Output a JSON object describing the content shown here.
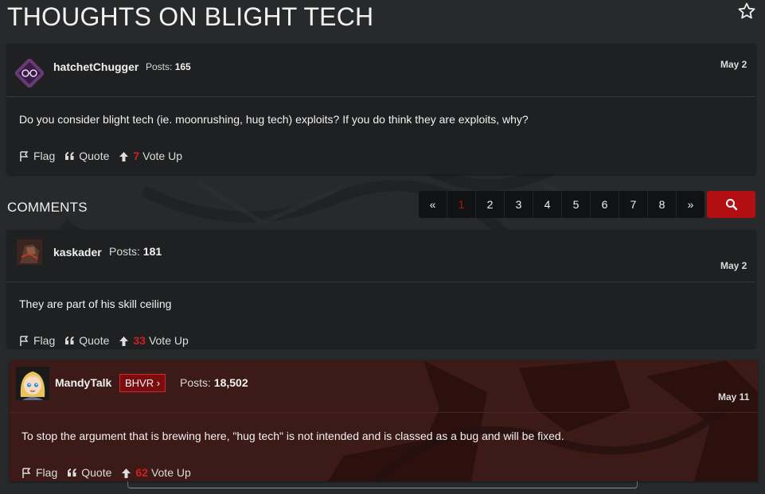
{
  "page": {
    "title": "THOUGHTS ON BLIGHT TECH"
  },
  "icons": {
    "favorite": "star-outline-icon",
    "flag": "flag-icon",
    "quote": "quote-icon",
    "vote": "arrow-up-icon",
    "search": "search-icon"
  },
  "colors": {
    "accent": "#b30f12",
    "vote_count": "#d21f1f",
    "background": "#27292b",
    "card": "#1f2021"
  },
  "op": {
    "username": "hatchetChugger",
    "posts_label": "Posts:",
    "posts_count": "165",
    "date": "May 2",
    "body": "Do you consider blight tech (ie. moonrushing, hug tech) exploits? If you do think they are exploits, why?",
    "actions": {
      "flag": "Flag",
      "quote": "Quote",
      "votes": "7",
      "vote_label": "Vote Up"
    }
  },
  "comments_heading": "COMMENTS",
  "pagination": {
    "prev": "«",
    "pages": [
      "1",
      "2",
      "3",
      "4",
      "5",
      "6",
      "7",
      "8"
    ],
    "next": "»",
    "current": "1"
  },
  "comments": [
    {
      "username": "kaskader",
      "posts_label": "Posts:",
      "posts_count": "181",
      "date": "May 2",
      "body": "They are part of his skill ceiling",
      "actions": {
        "flag": "Flag",
        "quote": "Quote",
        "votes": "33",
        "vote_label": "Vote Up"
      }
    },
    {
      "username": "MandyTalk",
      "badge": "BHVR ›",
      "posts_label": "Posts:",
      "posts_count": "18,502",
      "date": "May 11",
      "body": "To stop the argument that is brewing here, \"hug tech\" is not intended and is classed as a bug and will be fixed.",
      "actions": {
        "flag": "Flag",
        "quote": "Quote",
        "votes": "62",
        "vote_label": "Vote Up"
      }
    }
  ]
}
